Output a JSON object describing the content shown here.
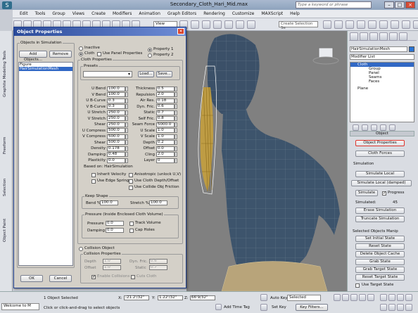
{
  "window": {
    "title": "Secondary_Cloth_Hari_Mid.max",
    "search_placeholder": "Type a keyword or phrase",
    "logo": "S"
  },
  "menu": [
    "Edit",
    "Tools",
    "Group",
    "Views",
    "Create",
    "Modifiers",
    "Animation",
    "Graph Editors",
    "Rendering",
    "Customize",
    "MAXScript",
    "Help"
  ],
  "toolbar": {
    "view_select": "View",
    "selection_set": "Create Selection Se"
  },
  "left_tabs": [
    "Graphite Modeling Tools",
    "Freeform",
    "Selection",
    "Object Paint"
  ],
  "dialog": {
    "title": "Object Properties",
    "objects_group": "Objects in Simulation",
    "add_objects": "Add Objects...",
    "remove": "Remove",
    "objects": [
      "Figure",
      "HairSimulationMesh"
    ],
    "inactive": "Inactive",
    "cloth": "Cloth",
    "use_panel_props": "Use Panel Properties",
    "property1": "Property 1",
    "property2": "Property 2",
    "cloth_properties": "Cloth Properties",
    "presets": "Presets",
    "load": "Load...",
    "save": "Save...",
    "left_params": [
      {
        "label": "U Bend",
        "value": "100.0"
      },
      {
        "label": "V Bend",
        "value": "100.0"
      },
      {
        "label": "U B-Curve",
        "value": "0.3"
      },
      {
        "label": "V B-Curve",
        "value": "0.3"
      },
      {
        "label": "U Stretch",
        "value": "250.0"
      },
      {
        "label": "V Stretch",
        "value": "250.0"
      },
      {
        "label": "Shear",
        "value": "250.0"
      },
      {
        "label": "U Compress",
        "value": "500.0"
      },
      {
        "label": "V Compress",
        "value": "500.0"
      },
      {
        "label": "Shear",
        "value": "500.0"
      },
      {
        "label": "Density",
        "value": "0.178"
      },
      {
        "label": "Damping",
        "value": "0.48"
      },
      {
        "label": "Plasticity",
        "value": "0.0"
      }
    ],
    "right_params": [
      {
        "label": "Thickness",
        "value": "0.5"
      },
      {
        "label": "Repulsion",
        "value": "2.0"
      },
      {
        "label": "Air Res.",
        "value": "0.18"
      },
      {
        "label": "Dyn. Fric.",
        "value": "0.6"
      },
      {
        "label": "Static",
        "value": "0.7"
      },
      {
        "label": "Self Fric.",
        "value": "0.8"
      },
      {
        "label": "Seam Force",
        "value": "5000.0"
      },
      {
        "label": "U Scale",
        "value": "1.0"
      },
      {
        "label": "V Scale",
        "value": "1.0"
      },
      {
        "label": "Depth",
        "value": "0.2"
      },
      {
        "label": "Offset",
        "value": "0.0"
      },
      {
        "label": "Cling",
        "value": "2.0"
      },
      {
        "label": "Layer",
        "value": "0"
      }
    ],
    "based_on": "Based on: HairSimulation",
    "inherit_velocity": "Inherit Velocity",
    "anisotropic": "Anisotropic (unlock U,V)",
    "use_edge_springs": "Use Edge Springs",
    "use_cloth_depth": "Use Cloth Depth/Offset",
    "use_collide_friction": "Use Collide Obj Friction",
    "keep_shape": "Keep Shape",
    "bend_pct_label": "Bend %",
    "bend_pct": "100.0",
    "stretch_pct_label": "Stretch %",
    "stretch_pct": "100.0",
    "pressure_group": "Pressure (Inside Enclosed Cloth Volume)",
    "pressure_label": "Pressure",
    "pressure": "0.0",
    "damping_label": "Damping",
    "damping": "0.0",
    "track_volume": "Track Volume",
    "cap_holes": "Cap Holes",
    "collision_object": "Collision Object",
    "collision_properties": "Collision Properties",
    "depth_label": "Depth",
    "depth": "1.0",
    "offset_label": "Offset",
    "offset": "1.0",
    "dynfric_label": "Dyn. Fric.",
    "dynfric": "0.6",
    "static_label": "Static",
    "static": "0.7",
    "enable_collisions": "Enable Collisions",
    "cuts_cloth": "Cuts Cloth",
    "ok": "OK",
    "cancel": "Cancel"
  },
  "viewport": {
    "label": ""
  },
  "cmd": {
    "object_name": "HairSimulationMesh",
    "modifier_list": "Modifier List",
    "stack": [
      "Cloth",
      "Group",
      "Panel",
      "Seams",
      "Faces"
    ],
    "stack_plane": "Plane",
    "object_section": "Object",
    "object_properties": "Object Properties",
    "cloth_forces": "Cloth Forces",
    "simulation_section": "Simulation",
    "simulate_local": "Simulate Local",
    "simulate_local_damped": "Simulate Local (damped)",
    "simulate": "Simulate",
    "progress": "Progress",
    "simulated_label": "Simulated:",
    "simulated_value": "45",
    "erase_simulation": "Erase Simulation",
    "truncate_simulation": "Truncate Simulation",
    "selected_objects_manip": "Selected Objects Manip",
    "set_initial_state": "Set Initial State",
    "reset_state": "Reset State",
    "delete_object_cache": "Delete Object Cache",
    "grab_state": "Grab State",
    "grab_target_state": "Grab Target State",
    "reset_target_state": "Reset Target State",
    "use_target_state": "Use Target State"
  },
  "status": {
    "welcome": "Welcome to M",
    "selected": "1 Object Selected",
    "hint": "Click or click-and-drag to select objects",
    "coord_x": "-21.2'/32\"",
    "coord_y": "1.22'/32\"",
    "coord_z": "66'9/32\"",
    "add_time_tag": "Add Time Tag",
    "auto_key": "Auto Key",
    "auto_key_mode": "Selected",
    "set_key": "Set Key",
    "key_filters": "Key Filters..."
  },
  "colors": {
    "accent": "#3168c5",
    "highlight_border": "#e0342a",
    "hair": "#c9a13a",
    "body": "#3a4f66"
  }
}
